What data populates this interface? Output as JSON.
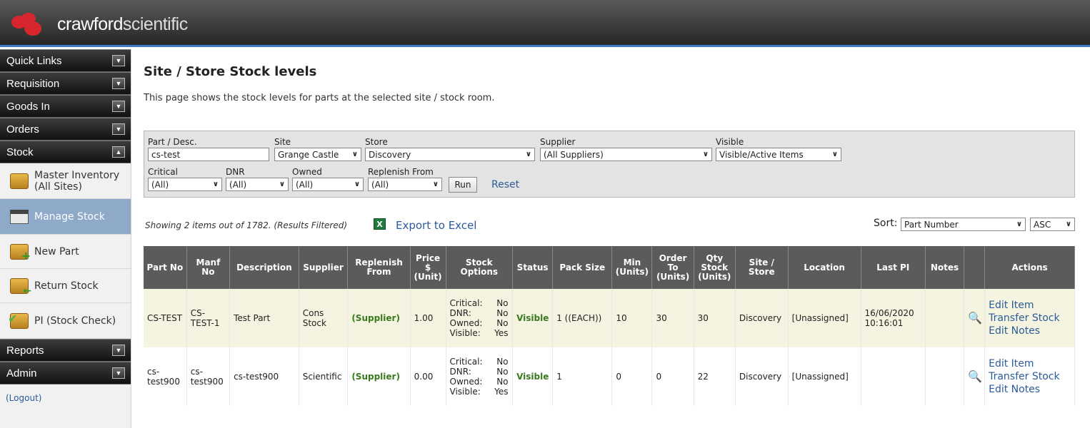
{
  "brand": {
    "name_part1": "crawford",
    "name_part2": "scientific"
  },
  "sidebar": {
    "menus": [
      {
        "label": "Quick Links",
        "state": "collapsed"
      },
      {
        "label": "Requisition",
        "state": "collapsed"
      },
      {
        "label": "Goods In",
        "state": "collapsed"
      },
      {
        "label": "Orders",
        "state": "collapsed"
      },
      {
        "label": "Stock",
        "state": "expanded"
      }
    ],
    "stock_items": [
      {
        "label": "Master Inventory (All Sites)",
        "icon": "boxes-icon"
      },
      {
        "label": "Manage Stock",
        "icon": "clapper-icon",
        "active": true
      },
      {
        "label": "New Part",
        "icon": "new-part-icon"
      },
      {
        "label": "Return Stock",
        "icon": "return-stock-icon"
      },
      {
        "label": "PI (Stock Check)",
        "icon": "stock-check-icon"
      }
    ],
    "menus_after": [
      {
        "label": "Reports",
        "state": "collapsed"
      },
      {
        "label": "Admin",
        "state": "collapsed"
      }
    ],
    "logout": "(Logout)"
  },
  "page": {
    "title": "Site / Store Stock levels",
    "intro": "This page shows the stock levels for parts at the selected site / stock room."
  },
  "filters": {
    "part_desc": {
      "label": "Part / Desc.",
      "value": "cs-test"
    },
    "site": {
      "label": "Site",
      "value": "Grange Castle"
    },
    "store": {
      "label": "Store",
      "value": "Discovery"
    },
    "supplier": {
      "label": "Supplier",
      "value": "(All Suppliers)"
    },
    "visible": {
      "label": "Visible",
      "value": "Visible/Active Items"
    },
    "critical": {
      "label": "Critical",
      "value": "(All)"
    },
    "dnr": {
      "label": "DNR",
      "value": "(All)"
    },
    "owned": {
      "label": "Owned",
      "value": "(All)"
    },
    "replenish": {
      "label": "Replenish From",
      "value": "(All)"
    },
    "run": "Run",
    "reset": "Reset"
  },
  "results": {
    "showing": "Showing 2 items out of 1782. (Results Filtered)",
    "export": "Export to Excel",
    "sort_label": "Sort:",
    "sort_field": "Part Number",
    "sort_dir": "ASC"
  },
  "table": {
    "headers": [
      "Part No",
      "Manf No",
      "Description",
      "Supplier",
      "Replenish From",
      "Price $ (Unit)",
      "Stock Options",
      "Status",
      "Pack Size",
      "Min (Units)",
      "Order To (Units)",
      "Qty Stock (Units)",
      "Site / Store",
      "Location",
      "Last PI",
      "Notes",
      "",
      "Actions"
    ],
    "rows": [
      {
        "part_no": "CS-TEST",
        "manf_no": "CS-TEST-1",
        "description": "Test Part",
        "supplier": "Cons Stock",
        "replenish": "(Supplier)",
        "price": "1.00",
        "opts": {
          "critical_label": "Critical:",
          "critical": "No",
          "dnr_label": "DNR:",
          "dnr": "No",
          "owned_label": "Owned:",
          "owned": "No",
          "visible_label": "Visible:",
          "visible": "Yes"
        },
        "status": "Visible",
        "pack_size": "1 ((EACH))",
        "min": "10",
        "order_to": "30",
        "qty": "30",
        "site_store": "Discovery",
        "location": "[Unassigned]",
        "last_pi": "16/06/2020 10:16:01",
        "notes": "",
        "actions": [
          "Edit Item",
          "Transfer Stock",
          "Edit Notes"
        ]
      },
      {
        "part_no": "cs-test900",
        "manf_no": "cs-test900",
        "description": "cs-test900",
        "supplier": "Scientific",
        "replenish": "(Supplier)",
        "price": "0.00",
        "opts": {
          "critical_label": "Critical:",
          "critical": "No",
          "dnr_label": "DNR:",
          "dnr": "No",
          "owned_label": "Owned:",
          "owned": "No",
          "visible_label": "Visible:",
          "visible": "Yes"
        },
        "status": "Visible",
        "pack_size": "1",
        "min": "0",
        "order_to": "0",
        "qty": "22",
        "site_store": "Discovery",
        "location": "[Unassigned]",
        "last_pi": "",
        "notes": "",
        "actions": [
          "Edit Item",
          "Transfer Stock",
          "Edit Notes"
        ]
      }
    ]
  },
  "colors": {
    "header_accent": "#3d7cc9",
    "active_nav": "#8fa9c8",
    "link": "#2b5b9b",
    "status_green": "#3a7a1f",
    "row_highlight": "#f4f4e0"
  }
}
